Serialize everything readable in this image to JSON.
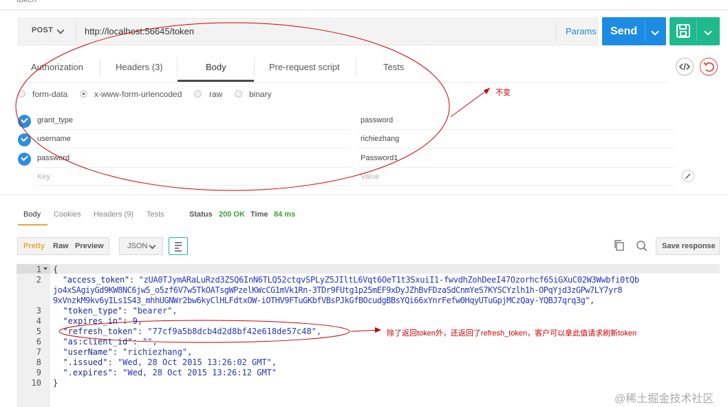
{
  "window": {
    "title": "token"
  },
  "request": {
    "method": "POST",
    "url": "http://localhost:56645/token",
    "params_label": "Params",
    "send_label": "Send"
  },
  "tabs": [
    "Authorization",
    "Headers (3)",
    "Body",
    "Pre-request script",
    "Tests"
  ],
  "body_modes": [
    "form-data",
    "x-www-form-urlencoded",
    "raw",
    "binary"
  ],
  "body_mode_selected": "x-www-form-urlencoded",
  "form_rows": [
    {
      "key": "grant_type",
      "value": "password"
    },
    {
      "key": "username",
      "value": "richiezhang"
    },
    {
      "key": "password",
      "value": "Password1"
    }
  ],
  "placeholders": {
    "key": "Key",
    "value": "Value"
  },
  "annotation_top": "不变",
  "response": {
    "tabs": [
      "Body",
      "Cookies",
      "Headers (9)",
      "Tests"
    ],
    "status_label": "Status",
    "status_value": "200 OK",
    "time_label": "Time",
    "time_value": "84 ms",
    "view_modes": [
      "Pretty",
      "Raw",
      "Preview"
    ],
    "format": "JSON",
    "save_response": "Save response",
    "line_numbers": [
      "1",
      "2",
      "",
      "",
      "3",
      "4",
      "5",
      "6",
      "7",
      "8",
      "9",
      "10"
    ],
    "code": {
      "l1": "{",
      "l2_key": "\"access_token\"",
      "l2_val": "\"zUA0TJymARaLuRzd3ZSQ6InN6TLQ52ctqvSPLyZ5JIltL6Vqt6OeT1t3SxuiI1-fwvdhZohDeeI47Ozorhcf65iGXuC02W3Wwbfi0tQb",
      "l2b": "jo4xSAgiyGd9KW8NC6jw5_o5zf6V7w5TkOATsgWPzelKWcCG1mVk1Rn-3TDr9FUtg1p25mEF9xDyJZhBvFDzaSdCnmYeS7KYSCYzlh1h-OPqYjd3zGPw7LY7yr8",
      "l2c": "9xVnzkM9kv6yILs1S43_mhhUGNWr2bw6kyClHLFdtxOW-iOTHV9FTuGKbfVBsPJkGfBOcudgBBsYQi66xYnrFefw0HqyUTuGpjMCzQay-YQBJ7qrq3g\",",
      "l3_key": "\"token_type\"",
      "l3_val": "\"bearer\",",
      "l4_key": "\"expires_in\"",
      "l4_val": "9,",
      "l5_key": "\"refresh_token\"",
      "l5_val": "\"77cf9a5b8dcb4d2d8bf42e618de57c48\",",
      "l6_key": "\"as:client_id\"",
      "l6_val": "\"\",",
      "l7_key": "\"userName\"",
      "l7_val": "\"richiezhang\",",
      "l8_key": "\".issued\"",
      "l8_val": "\"Wed, 28 Oct 2015 13:26:02 GMT\",",
      "l9_key": "\".expires\"",
      "l9_val": "\"Wed, 28 Oct 2015 13:26:12 GMT\"",
      "l10": "}"
    },
    "annotation": "除了返回token外，还返回了refresh_token，客户可以拿此值请求刷新token"
  },
  "watermark": "@稀土掘金技术社区",
  "colors": {
    "send": "#1c8ce3",
    "save": "#1fb98e",
    "status_ok": "#3aa13a",
    "annotation": "#cc0000"
  }
}
